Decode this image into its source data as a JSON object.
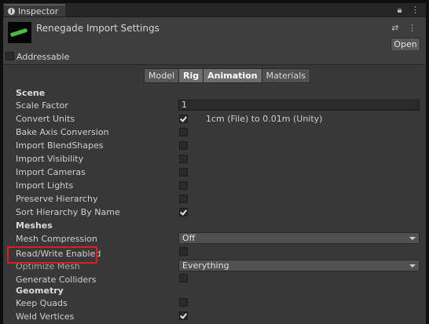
{
  "window": {
    "tab_label": "Inspector",
    "tab_icons": [
      "lock-icon",
      "kebab-menu-icon"
    ]
  },
  "header": {
    "title": "Renegade Import Settings",
    "open_button": "Open",
    "addressable_label": "Addressable",
    "addressable_checked": false,
    "icons": [
      "preset-sliders-icon",
      "kebab-menu-icon"
    ]
  },
  "tabs": [
    {
      "label": "Model",
      "active": false
    },
    {
      "label": "Rig",
      "active": true
    },
    {
      "label": "Animation",
      "active": true
    },
    {
      "label": "Materials",
      "active": false
    }
  ],
  "scene": {
    "heading": "Scene",
    "scale_factor_label": "Scale Factor",
    "scale_factor_value": "1",
    "convert_units_label": "Convert Units",
    "convert_units_checked": true,
    "convert_units_text": "1cm (File) to 0.01m (Unity)",
    "rows": [
      {
        "label": "Bake Axis Conversion",
        "checked": false
      },
      {
        "label": "Import BlendShapes",
        "checked": false
      },
      {
        "label": "Import Visibility",
        "checked": false
      },
      {
        "label": "Import Cameras",
        "checked": false
      },
      {
        "label": "Import Lights",
        "checked": false
      },
      {
        "label": "Preserve Hierarchy",
        "checked": false
      },
      {
        "label": "Sort Hierarchy By Name",
        "checked": true
      }
    ]
  },
  "meshes": {
    "heading": "Meshes",
    "mesh_compression_label": "Mesh Compression",
    "mesh_compression_value": "Off",
    "read_write_label": "Read/Write Enabled",
    "read_write_checked": false,
    "optimize_mesh_label": "Optimize Mesh",
    "optimize_mesh_value": "Everything",
    "generate_colliders_label": "Generate Colliders",
    "generate_colliders_checked": false
  },
  "geometry": {
    "heading": "Geometry",
    "keep_quads_label": "Keep Quads",
    "keep_quads_checked": false,
    "weld_vertices_label": "Weld Vertices",
    "weld_vertices_checked": true
  },
  "colors": {
    "panel_bg": "#383838",
    "highlight_box": "#e01b24"
  }
}
